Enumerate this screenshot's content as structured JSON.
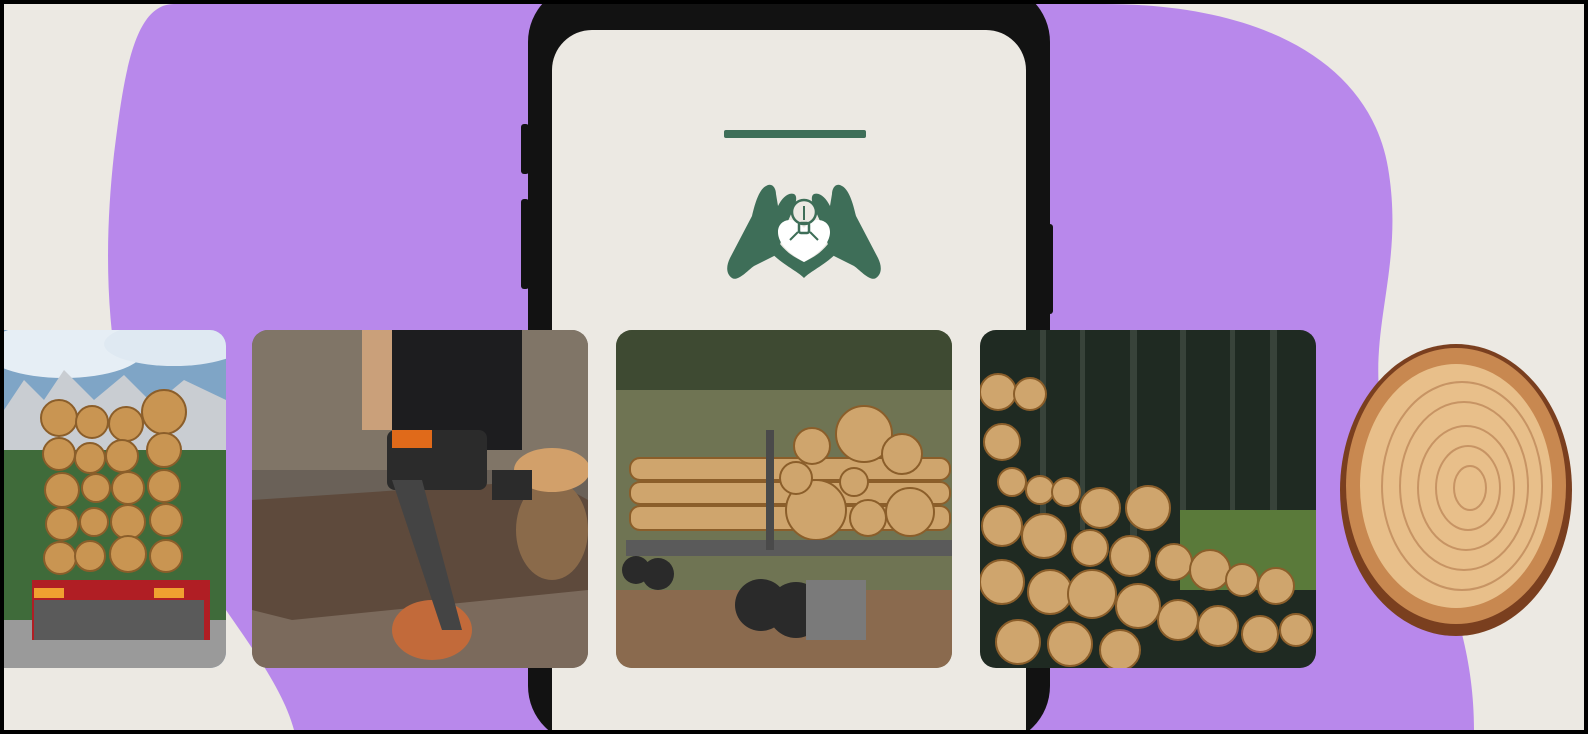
{
  "scene": {
    "colors": {
      "background": "#ece9e3",
      "blob": "#b888eb",
      "phone_frame": "#121212",
      "brand_green": "#3e6e58"
    },
    "phone": {
      "logo_icon": "hands-heart-lightbulb-icon",
      "divider": "header-bar"
    },
    "photos": [
      {
        "icon": "logging-truck-photo"
      },
      {
        "icon": "chainsaw-cutting-photo"
      },
      {
        "icon": "log-trailer-photo"
      },
      {
        "icon": "stacked-logs-forest-photo"
      },
      {
        "icon": "tree-stump-slice-photo"
      }
    ]
  }
}
